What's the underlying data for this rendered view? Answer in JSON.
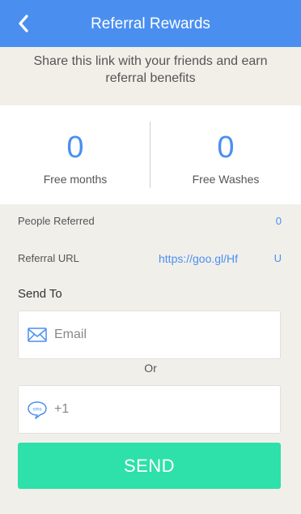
{
  "header": {
    "title": "Referral Rewards"
  },
  "intro": {
    "text": "Share this link with your friends and earn referral benefits"
  },
  "stats": [
    {
      "value": "0",
      "label": "Free months"
    },
    {
      "value": "0",
      "label": "Free Washes"
    }
  ],
  "details": {
    "people_referred": {
      "label": "People Referred",
      "value": "0"
    },
    "referral_url": {
      "label": "Referral URL",
      "value": "https://goo.gl/Hf",
      "suffix": "U"
    }
  },
  "send_to": {
    "label": "Send To"
  },
  "email_field": {
    "placeholder": "Email",
    "icon": "envelope-icon"
  },
  "or_text": "Or",
  "phone_field": {
    "placeholder": "+1",
    "icon": "sms-bubble-icon"
  },
  "send_button": {
    "label": "SEND"
  },
  "colors": {
    "accent": "#4a8ff0",
    "send": "#2ee0a9",
    "background": "#f1efea"
  }
}
